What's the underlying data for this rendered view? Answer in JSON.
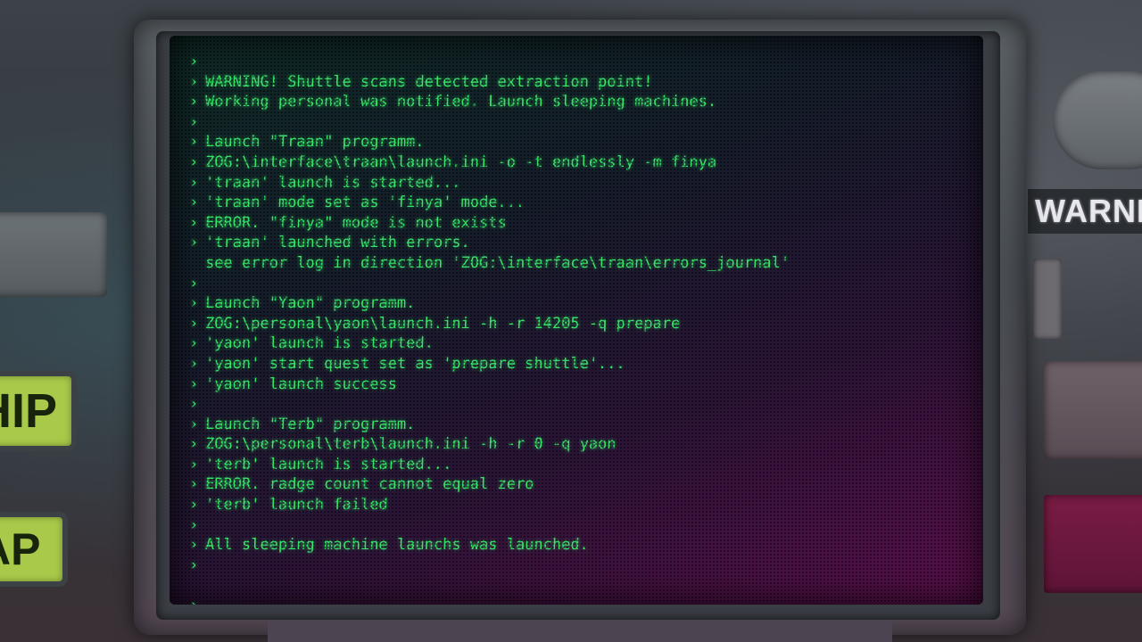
{
  "terminal": {
    "lines": [
      "",
      "WARNING! Shuttle scans detected extraction point!",
      "Working personal was notified. Launch sleeping machines.",
      "",
      "Launch \"Traan\" programm.",
      "ZOG:\\interface\\traan\\launch.ini -o -t endlessly -m finya",
      "'traan' launch is started...",
      "'traan' mode set as 'finya' mode...",
      "ERROR. \"finya\" mode is not exists",
      "'traan' launched with errors.",
      "see error log in direction 'ZOG:\\interface\\traan\\errors_journal'",
      "",
      "Launch \"Yaon\" programm.",
      "ZOG:\\personal\\yaon\\launch.ini -h -r 14205 -q prepare",
      "'yaon' launch is started.",
      "'yaon' start quest set as 'prepare shuttle'...",
      "'yaon' launch success",
      "",
      "Launch \"Terb\" programm.",
      "ZOG:\\personal\\terb\\launch.ini -h -r 0 -q yaon",
      "'terb' launch is started...",
      "ERROR. radge count cannot equal zero",
      "'terb' launch failed",
      "",
      "All sleeping machine launchs was launched.",
      "",
      "",
      ""
    ],
    "prompt_symbol": "›",
    "no_prompt_lines": [
      10,
      26
    ]
  },
  "side_panels": {
    "left_button_top": "HIP",
    "left_button_bottom": "AP",
    "right_sign": "WARNI"
  },
  "colors": {
    "terminal_text": "#38e36a",
    "button_green": "#a8c94a",
    "screen_magenta": "#5a0f4a"
  }
}
